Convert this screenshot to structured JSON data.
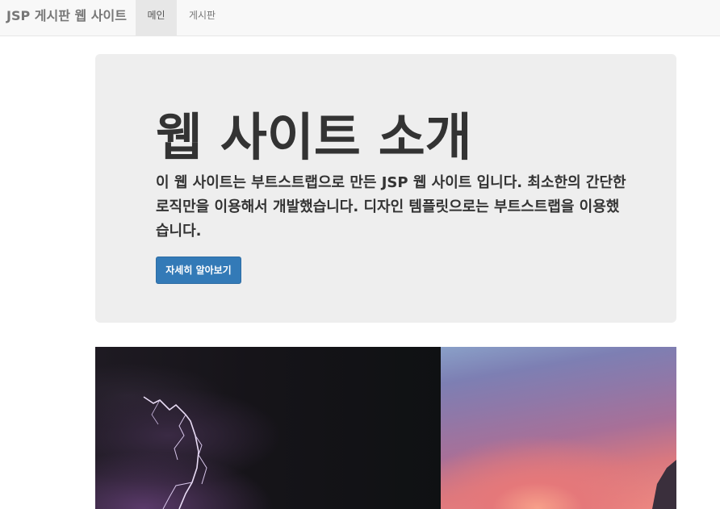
{
  "navbar": {
    "brand": "JSP 게시판 웹 사이트",
    "items": [
      {
        "label": "메인",
        "active": true
      },
      {
        "label": "게시판",
        "active": false
      }
    ]
  },
  "jumbotron": {
    "title": "웹 사이트 소개",
    "description": "이 웹 사이트는 부트스트랩으로 만든 JSP 웹 사이트 입니다. 최소한의 간단한 로직만을 이용해서 개발했습니다. 디자인 템플릿으로는 부트스트랩을 이용했습니다.",
    "button_label": "자세히 알아보기"
  },
  "carousel": {
    "slides": [
      "storm-lightning-image",
      "sunset-clouds-image"
    ]
  },
  "colors": {
    "navbar_bg": "#f8f8f8",
    "jumbotron_bg": "#eeeeee",
    "primary": "#337ab7"
  }
}
